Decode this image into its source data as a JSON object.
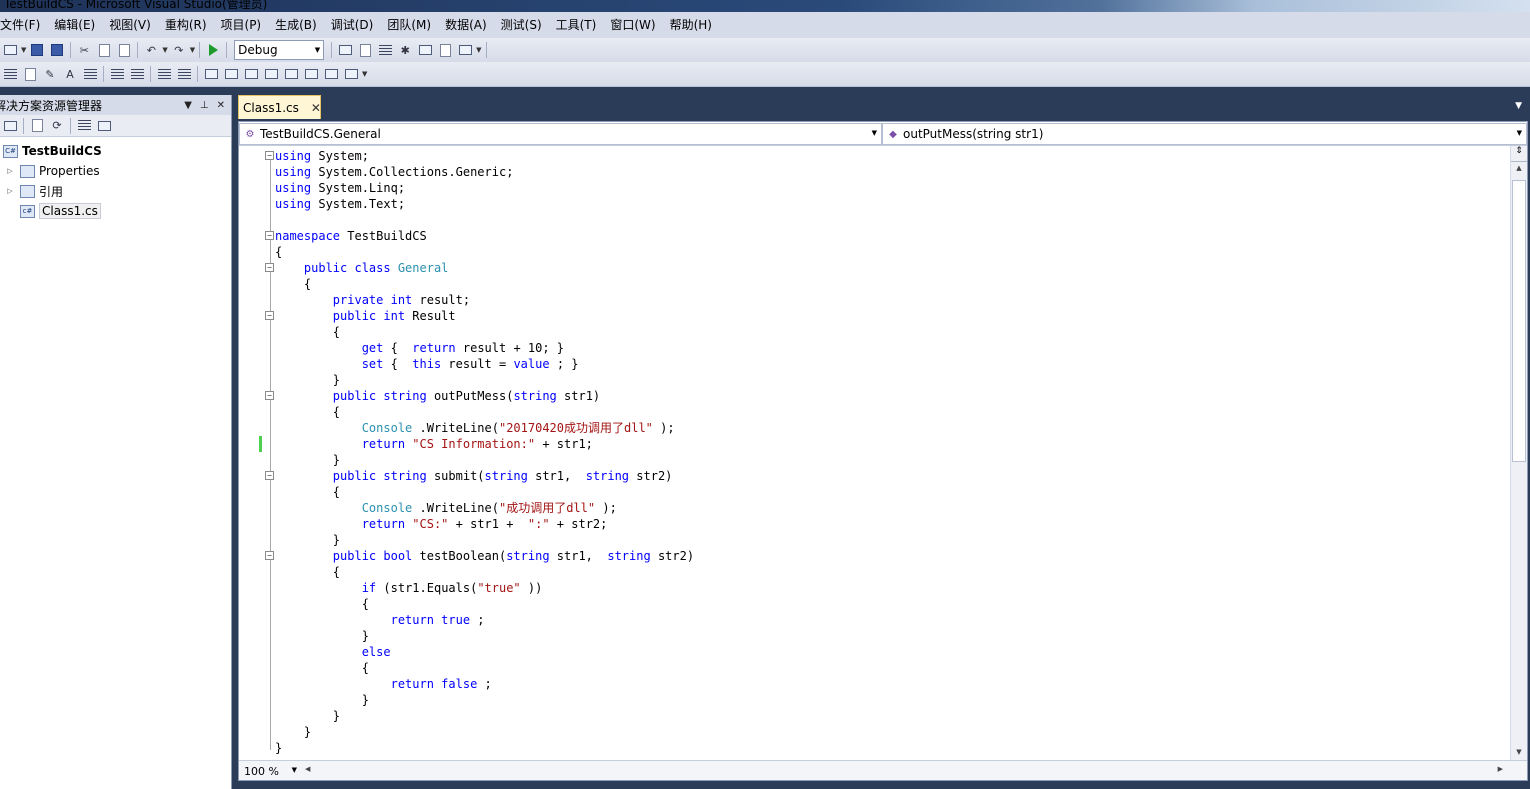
{
  "window": {
    "title": "TestBuildCS - Microsoft Visual Studio(管理员)"
  },
  "menu": [
    "文件(F)",
    "编辑(E)",
    "视图(V)",
    "重构(R)",
    "项目(P)",
    "生成(B)",
    "调试(D)",
    "团队(M)",
    "数据(A)",
    "测试(S)",
    "工具(T)",
    "窗口(W)",
    "帮助(H)"
  ],
  "toolbar": {
    "configuration": "Debug"
  },
  "solution_explorer": {
    "title": "解决方案资源管理器",
    "project": "TestBuildCS",
    "items": [
      "Properties",
      "引用",
      "Class1.cs"
    ]
  },
  "editor": {
    "tab_label": "Class1.cs",
    "type_dropdown": "TestBuildCS.General",
    "member_dropdown": "outPutMess(string str1)",
    "zoom": "100 %"
  },
  "code_lines": [
    [
      [
        "kw",
        "using"
      ],
      [
        "",
        "System;"
      ]
    ],
    [
      [
        "kw",
        "using"
      ],
      [
        "",
        "System.Collections.Generic;"
      ]
    ],
    [
      [
        "kw",
        "using"
      ],
      [
        "",
        "System.Linq;"
      ]
    ],
    [
      [
        "kw",
        "using"
      ],
      [
        "",
        "System.Text;"
      ]
    ],
    [],
    [
      [
        "kw",
        "namespace"
      ],
      [
        "",
        "TestBuildCS"
      ]
    ],
    [
      [
        "",
        "{"
      ]
    ],
    [
      [
        "",
        "    "
      ],
      [
        "kw",
        "public class"
      ],
      [
        "ty",
        "General"
      ]
    ],
    [
      [
        "",
        "    {"
      ]
    ],
    [
      [
        "",
        "        "
      ],
      [
        "kw",
        "private int"
      ],
      [
        "",
        "result;"
      ]
    ],
    [
      [
        "",
        "        "
      ],
      [
        "kw",
        "public int"
      ],
      [
        "",
        "Result"
      ]
    ],
    [
      [
        "",
        "        {"
      ]
    ],
    [
      [
        "",
        "            "
      ],
      [
        "kw",
        "get"
      ],
      [
        "",
        "{ "
      ],
      [
        "kw",
        "return"
      ],
      [
        "",
        "result + 10; }"
      ]
    ],
    [
      [
        "",
        "            "
      ],
      [
        "kw",
        "set"
      ],
      [
        "",
        "{ "
      ],
      [
        "kw",
        "this"
      ],
      [
        ".",
        "result = "
      ],
      [
        "kw",
        "value"
      ],
      [
        "",
        "; }"
      ]
    ],
    [
      [
        "",
        "        }"
      ]
    ],
    [
      [
        "",
        "        "
      ],
      [
        "kw",
        "public string"
      ],
      [
        "",
        "outPutMess("
      ],
      [
        "kw",
        "string"
      ],
      [
        "",
        "str1)"
      ]
    ],
    [
      [
        "",
        "        {"
      ]
    ],
    [
      [
        "",
        "            "
      ],
      [
        "ty",
        "Console"
      ],
      [
        "",
        ".WriteLine("
      ],
      [
        "st",
        "\"20170420成功调用了dll\""
      ],
      [
        "",
        ");"
      ]
    ],
    [
      [
        "",
        "            "
      ],
      [
        "kw",
        "return"
      ],
      [
        "st",
        "\"CS Information:\""
      ],
      [
        "",
        "+ str1;"
      ]
    ],
    [
      [
        "",
        "        }"
      ]
    ],
    [
      [
        "",
        "        "
      ],
      [
        "kw",
        "public string"
      ],
      [
        "",
        "submit("
      ],
      [
        "kw",
        "string"
      ],
      [
        "",
        "str1, "
      ],
      [
        "kw",
        "string"
      ],
      [
        "",
        "str2)"
      ]
    ],
    [
      [
        "",
        "        {"
      ]
    ],
    [
      [
        "",
        "            "
      ],
      [
        "ty",
        "Console"
      ],
      [
        "",
        ".WriteLine("
      ],
      [
        "st",
        "\"成功调用了dll\""
      ],
      [
        "",
        ");"
      ]
    ],
    [
      [
        "",
        "            "
      ],
      [
        "kw",
        "return"
      ],
      [
        "st",
        "\"CS:\""
      ],
      [
        "",
        "+ str1 + "
      ],
      [
        "st",
        "\":\""
      ],
      [
        "",
        "+ str2;"
      ]
    ],
    [
      [
        "",
        "        }"
      ]
    ],
    [
      [
        "",
        "        "
      ],
      [
        "kw",
        "public bool"
      ],
      [
        "",
        "testBoolean("
      ],
      [
        "kw",
        "string"
      ],
      [
        "",
        "str1, "
      ],
      [
        "kw",
        "string"
      ],
      [
        "",
        "str2)"
      ]
    ],
    [
      [
        "",
        "        {"
      ]
    ],
    [
      [
        "",
        "            "
      ],
      [
        "kw",
        "if"
      ],
      [
        "",
        "(str1.Equals("
      ],
      [
        "st",
        "\"true\""
      ],
      [
        "",
        "))"
      ]
    ],
    [
      [
        "",
        "            {"
      ]
    ],
    [
      [
        "",
        "                "
      ],
      [
        "kw",
        "return true"
      ],
      [
        "",
        ";"
      ]
    ],
    [
      [
        "",
        "            }"
      ]
    ],
    [
      [
        "",
        "            "
      ],
      [
        "kw",
        "else"
      ]
    ],
    [
      [
        "",
        "            {"
      ]
    ],
    [
      [
        "",
        "                "
      ],
      [
        "kw",
        "return false"
      ],
      [
        "",
        ";"
      ]
    ],
    [
      [
        "",
        "            }"
      ]
    ],
    [
      [
        "",
        "        }"
      ]
    ],
    [
      [
        "",
        "    }"
      ]
    ],
    [
      [
        "",
        "}"
      ]
    ]
  ]
}
